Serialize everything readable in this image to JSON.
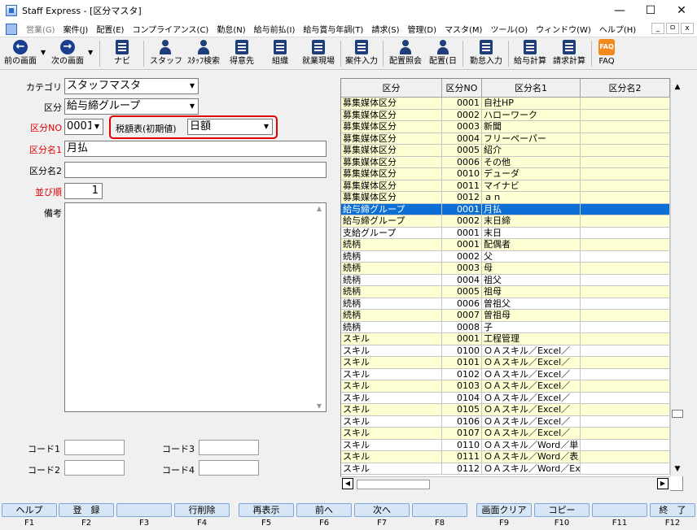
{
  "window": {
    "title": "Staff Express - [区分マスタ]",
    "minimize": "—",
    "maximize": "☐",
    "close": "✕"
  },
  "menu": {
    "items": [
      "営業(G)",
      "案件(J)",
      "配置(E)",
      "コンプライアンス(C)",
      "勤怠(N)",
      "給与前払(I)",
      "給与賞与年調(T)",
      "請求(S)",
      "管理(D)",
      "マスタ(M)",
      "ツール(O)",
      "ウィンドウ(W)",
      "ヘルプ(H)"
    ],
    "mdi": [
      "_",
      "ㅁ",
      "x"
    ]
  },
  "toolbar": {
    "prev": "前の画面",
    "next": "次の画面",
    "navi": "ナビ",
    "staff": "スタッフ",
    "staff_search": "ｽﾀｯﾌ検索",
    "client": "得意先",
    "org": "組織",
    "site": "就業現場",
    "case_input": "案件入力",
    "assign_ref": "配置照会",
    "assign": "配置(日",
    "attendance": "勤怠入力",
    "payroll": "給与計算",
    "billing": "請求計算",
    "faq": "FAQ",
    "faq_icon": "FAQ"
  },
  "form": {
    "category_label": "カテゴリ",
    "category_value": "スタッフマスタ",
    "kubun_label": "区分",
    "kubun_value": "給与締グループ",
    "kubun_no_label": "区分NO",
    "kubun_no_value": "0001",
    "tax_label": "税額表(初期値)",
    "tax_value": "日額",
    "name1_label": "区分名1",
    "name1_value": "月払",
    "name2_label": "区分名2",
    "name2_value": "",
    "order_label": "並び順",
    "order_value": "1",
    "memo_label": "備考",
    "code1": "コード1",
    "code2": "コード2",
    "code3": "コード3",
    "code4": "コード4"
  },
  "grid": {
    "headers": [
      "区分",
      "区分NO",
      "区分名1",
      "区分名2"
    ],
    "rows": [
      {
        "k": "募集媒体区分",
        "no": "0001",
        "n1": "自社HP",
        "n2": "",
        "c": "yellow"
      },
      {
        "k": "募集媒体区分",
        "no": "0002",
        "n1": "ハローワーク",
        "n2": "",
        "c": "yellow"
      },
      {
        "k": "募集媒体区分",
        "no": "0003",
        "n1": "新聞",
        "n2": "",
        "c": "yellow"
      },
      {
        "k": "募集媒体区分",
        "no": "0004",
        "n1": "フリーペーパー",
        "n2": "",
        "c": "yellow"
      },
      {
        "k": "募集媒体区分",
        "no": "0005",
        "n1": "紹介",
        "n2": "",
        "c": "yellow"
      },
      {
        "k": "募集媒体区分",
        "no": "0006",
        "n1": "その他",
        "n2": "",
        "c": "yellow"
      },
      {
        "k": "募集媒体区分",
        "no": "0010",
        "n1": "デューダ",
        "n2": "",
        "c": "yellow"
      },
      {
        "k": "募集媒体区分",
        "no": "0011",
        "n1": "マイナビ",
        "n2": "",
        "c": "yellow"
      },
      {
        "k": "募集媒体区分",
        "no": "0012",
        "n1": "ａｎ",
        "n2": "",
        "c": "yellow"
      },
      {
        "k": "給与締グループ",
        "no": "0001",
        "n1": "月払",
        "n2": "",
        "c": "selected"
      },
      {
        "k": "給与締グループ",
        "no": "0002",
        "n1": "末日締",
        "n2": "",
        "c": "yellow"
      },
      {
        "k": "支給グループ",
        "no": "0001",
        "n1": "末日",
        "n2": "",
        "c": "white"
      },
      {
        "k": "続柄",
        "no": "0001",
        "n1": "配偶者",
        "n2": "",
        "c": "yellow"
      },
      {
        "k": "続柄",
        "no": "0002",
        "n1": "父",
        "n2": "",
        "c": "white"
      },
      {
        "k": "続柄",
        "no": "0003",
        "n1": "母",
        "n2": "",
        "c": "yellow"
      },
      {
        "k": "続柄",
        "no": "0004",
        "n1": "祖父",
        "n2": "",
        "c": "white"
      },
      {
        "k": "続柄",
        "no": "0005",
        "n1": "祖母",
        "n2": "",
        "c": "yellow"
      },
      {
        "k": "続柄",
        "no": "0006",
        "n1": "曽祖父",
        "n2": "",
        "c": "white"
      },
      {
        "k": "続柄",
        "no": "0007",
        "n1": "曽祖母",
        "n2": "",
        "c": "yellow"
      },
      {
        "k": "続柄",
        "no": "0008",
        "n1": "子",
        "n2": "",
        "c": "white"
      },
      {
        "k": "スキル",
        "no": "0001",
        "n1": "工程管理",
        "n2": "",
        "c": "yellow"
      },
      {
        "k": "スキル",
        "no": "0100",
        "n1": "ＯＡスキル／Excel／",
        "n2": "",
        "c": "white"
      },
      {
        "k": "スキル",
        "no": "0101",
        "n1": "ＯＡスキル／Excel／",
        "n2": "",
        "c": "yellow"
      },
      {
        "k": "スキル",
        "no": "0102",
        "n1": "ＯＡスキル／Excel／",
        "n2": "",
        "c": "white"
      },
      {
        "k": "スキル",
        "no": "0103",
        "n1": "ＯＡスキル／Excel／",
        "n2": "",
        "c": "yellow"
      },
      {
        "k": "スキル",
        "no": "0104",
        "n1": "ＯＡスキル／Excel／",
        "n2": "",
        "c": "white"
      },
      {
        "k": "スキル",
        "no": "0105",
        "n1": "ＯＡスキル／Excel／",
        "n2": "",
        "c": "yellow"
      },
      {
        "k": "スキル",
        "no": "0106",
        "n1": "ＯＡスキル／Excel／",
        "n2": "",
        "c": "white"
      },
      {
        "k": "スキル",
        "no": "0107",
        "n1": "ＯＡスキル／Excel／",
        "n2": "",
        "c": "yellow"
      },
      {
        "k": "スキル",
        "no": "0110",
        "n1": "ＯＡスキル／Word／単",
        "n2": "",
        "c": "white"
      },
      {
        "k": "スキル",
        "no": "0111",
        "n1": "ＯＡスキル／Word／表",
        "n2": "",
        "c": "yellow"
      },
      {
        "k": "スキル",
        "no": "0112",
        "n1": "ＯＡスキル／Word／Ex",
        "n2": "",
        "c": "white"
      }
    ]
  },
  "fkeys": [
    {
      "label": "ヘルプ",
      "key": "F1"
    },
    {
      "label": "登　録",
      "key": "F2"
    },
    {
      "label": "",
      "key": "F3"
    },
    {
      "label": "行削除",
      "key": "F4"
    },
    {
      "label": "再表示",
      "key": "F5"
    },
    {
      "label": "前へ",
      "key": "F6"
    },
    {
      "label": "次へ",
      "key": "F7"
    },
    {
      "label": "",
      "key": "F8"
    },
    {
      "label": "画面クリア",
      "key": "F9"
    },
    {
      "label": "コピー",
      "key": "F10"
    },
    {
      "label": "",
      "key": "F11"
    },
    {
      "label": "終　了",
      "key": "F12"
    }
  ],
  "colors": {
    "selected": "#0b6fd6",
    "row_yellow": "#ffffd4",
    "required_label": "#e00000",
    "fkey_bg": "#d7e6f7"
  }
}
